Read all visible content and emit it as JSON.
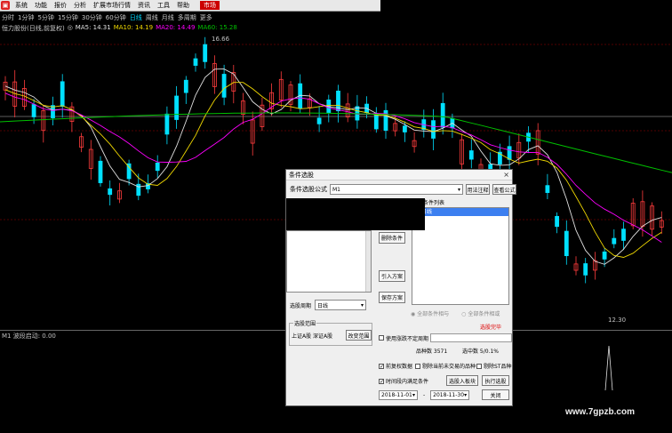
{
  "menu": {
    "items": [
      "系统",
      "功能",
      "报价",
      "分析",
      "扩展市场行情",
      "资讯",
      "工具",
      "帮助"
    ],
    "market": "市场"
  },
  "periods": [
    "分时",
    "1分钟",
    "5分钟",
    "15分钟",
    "30分钟",
    "60分钟",
    "日线",
    "周线",
    "月线",
    "多周期",
    "更多"
  ],
  "active_period": "日线",
  "ma_legend": {
    "stock": "恒力股份(日线,前复权)",
    "ma5": "MA5: 14.31",
    "ma10": "MA10: 14.19",
    "ma20": "MA20: 14.49",
    "ma60": "MA60: 15.28"
  },
  "colors": {
    "up": "#ff3c3c",
    "down": "#00e0ff",
    "ma5": "#e0e0e0",
    "ma10": "#f0d800",
    "ma20": "#ff00ff",
    "ma60": "#00c000",
    "grid_red": "#a00000"
  },
  "chart_labels": {
    "high": "16.66",
    "low": "12.30"
  },
  "sub_legend": "M1 波段启动: 0.00",
  "watermark": "www.7gpzb.com",
  "dialog": {
    "title": "条件选股",
    "close": "×",
    "formula_label": "条件选股公式",
    "formula_value": "M1",
    "btn_usage": "用法注释",
    "btn_view": "查看公式",
    "list_label": "选股条件列表",
    "list_item": "日线",
    "btn_delete": "删除条件",
    "btn_import": "引入方案",
    "btn_save": "保存方案",
    "period_label": "选股周期",
    "period_value": "日线",
    "radio_and": "全部条件相与",
    "radio_or": "全部条件相或",
    "status": "选股完毕",
    "range_legend": "选股范围",
    "range_text": "上证A股 深证A股",
    "btn_range": "改变范围",
    "chk_exclude": "使用涨跌不定周期",
    "stat_count": "品种数 3571",
    "stat_selected": "选中数 5/0.1%",
    "chk_fq": "前复权数据",
    "chk_notrade": "剔除当前未交易的品种",
    "chk_st": "剔除ST品种",
    "chk_time": "时间段内满足条件",
    "btn_add_block": "选股入板块",
    "btn_run": "执行选股",
    "date_from": "2018-11-01",
    "date_sep": "-",
    "date_to": "2018-11-30",
    "btn_close": "关闭"
  }
}
